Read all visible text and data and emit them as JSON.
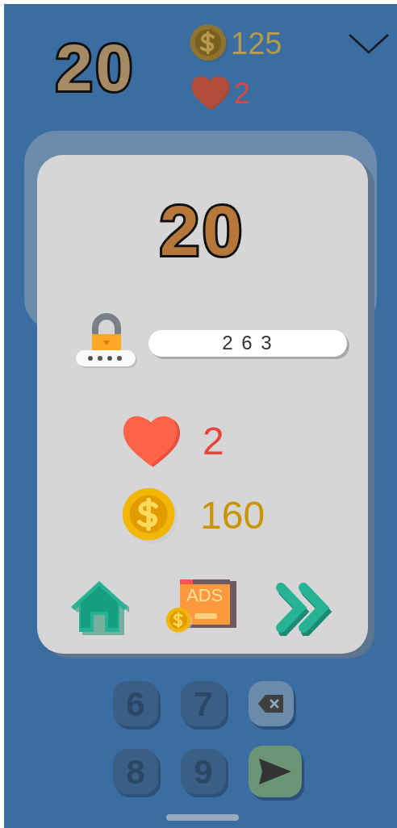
{
  "header": {
    "score": "20",
    "coins": "125",
    "lives": "2"
  },
  "dialog": {
    "score": "20",
    "code": "2 6 3",
    "lives": "2",
    "coins": "160",
    "ads_label": "ADS"
  },
  "keypad": [
    {
      "kind": "digit",
      "label": "6"
    },
    {
      "kind": "digit",
      "label": "7"
    },
    {
      "kind": "backspace"
    },
    {
      "kind": "digit",
      "label": "8"
    },
    {
      "kind": "digit",
      "label": "9"
    },
    {
      "kind": "send"
    }
  ]
}
